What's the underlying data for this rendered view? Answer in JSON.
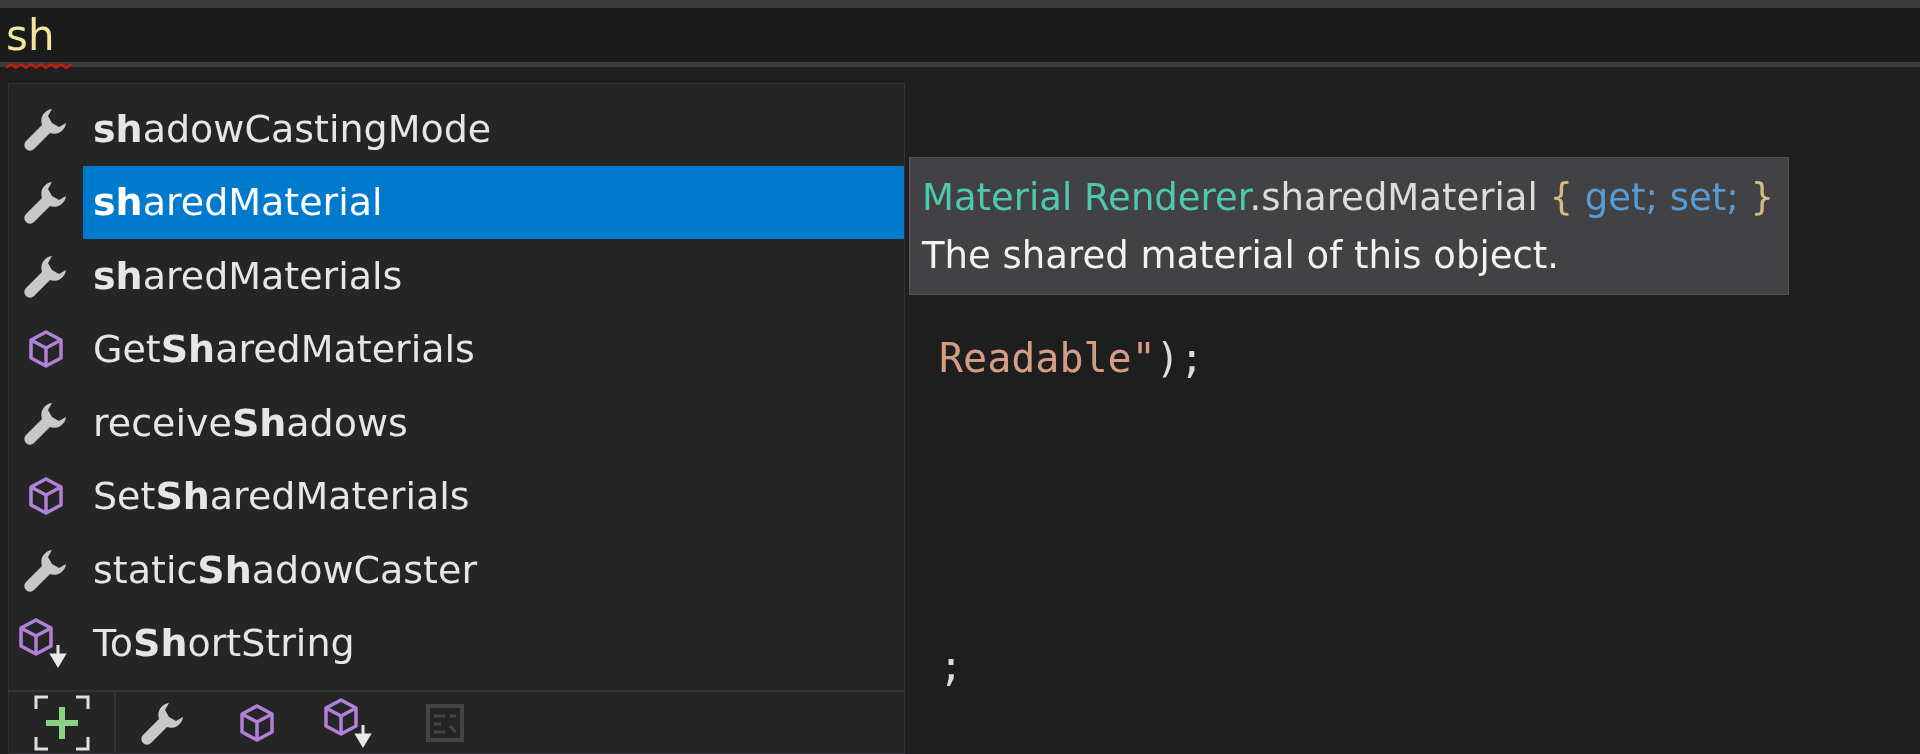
{
  "editor": {
    "typed_text": "sh",
    "error": true
  },
  "completion": {
    "items": [
      {
        "name": "**sh**adowCastingMode",
        "kind": "property",
        "selected": false
      },
      {
        "name": "**sh**aredMaterial",
        "kind": "property",
        "selected": true
      },
      {
        "name": "**sh**aredMaterials",
        "kind": "property",
        "selected": false
      },
      {
        "name": "Get**Sh**aredMaterials",
        "kind": "method",
        "selected": false
      },
      {
        "name": "receive**Sh**adows",
        "kind": "property",
        "selected": false
      },
      {
        "name": "Set**Sh**aredMaterials",
        "kind": "method",
        "selected": false
      },
      {
        "name": "static**Sh**adowCaster",
        "kind": "property",
        "selected": false
      },
      {
        "name": "To**Sh**ortString",
        "kind": "extension",
        "selected": false
      }
    ],
    "filters": [
      {
        "kind": "expand",
        "disabled": false
      },
      {
        "kind": "property",
        "disabled": false
      },
      {
        "kind": "method",
        "disabled": false
      },
      {
        "kind": "extension",
        "disabled": false
      },
      {
        "kind": "snippet",
        "disabled": true
      }
    ]
  },
  "tooltip": {
    "signature": [
      {
        "text": "Material Renderer",
        "kind": "type"
      },
      {
        "text": ".sharedMaterial ",
        "kind": "plain"
      },
      {
        "text": "{ ",
        "kind": "punct"
      },
      {
        "text": "get; set;",
        "kind": "keyword"
      },
      {
        "text": " }",
        "kind": "punct"
      }
    ],
    "description": "The shared material of this object."
  },
  "code": {
    "lines": [
      {
        "tokens": [
          {
            "text": "Readable\"",
            "kind": "string"
          },
          {
            "text": ");",
            "kind": "plain"
          }
        ]
      },
      {
        "tokens": [
          {
            "text": ";",
            "kind": "plain"
          }
        ]
      }
    ]
  }
}
